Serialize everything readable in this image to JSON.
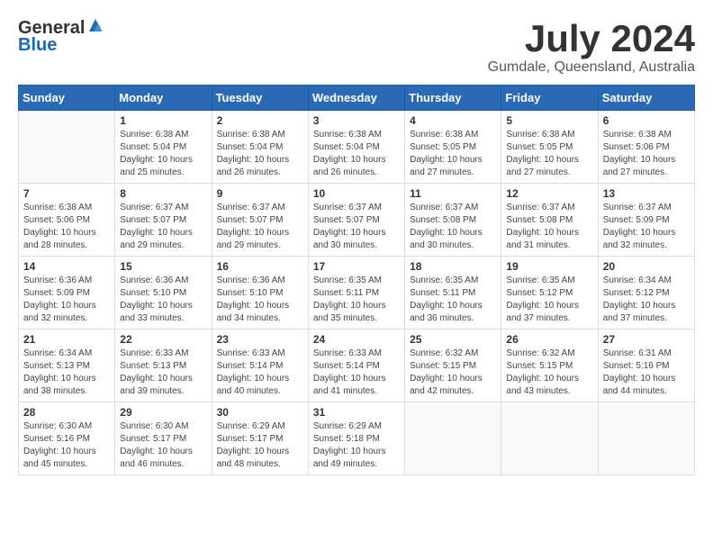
{
  "logo": {
    "general": "General",
    "blue": "Blue"
  },
  "title": "July 2024",
  "subtitle": "Gumdale, Queensland, Australia",
  "days_of_week": [
    "Sunday",
    "Monday",
    "Tuesday",
    "Wednesday",
    "Thursday",
    "Friday",
    "Saturday"
  ],
  "weeks": [
    [
      {
        "day": "",
        "info": ""
      },
      {
        "day": "1",
        "info": "Sunrise: 6:38 AM\nSunset: 5:04 PM\nDaylight: 10 hours\nand 25 minutes."
      },
      {
        "day": "2",
        "info": "Sunrise: 6:38 AM\nSunset: 5:04 PM\nDaylight: 10 hours\nand 26 minutes."
      },
      {
        "day": "3",
        "info": "Sunrise: 6:38 AM\nSunset: 5:04 PM\nDaylight: 10 hours\nand 26 minutes."
      },
      {
        "day": "4",
        "info": "Sunrise: 6:38 AM\nSunset: 5:05 PM\nDaylight: 10 hours\nand 27 minutes."
      },
      {
        "day": "5",
        "info": "Sunrise: 6:38 AM\nSunset: 5:05 PM\nDaylight: 10 hours\nand 27 minutes."
      },
      {
        "day": "6",
        "info": "Sunrise: 6:38 AM\nSunset: 5:06 PM\nDaylight: 10 hours\nand 27 minutes."
      }
    ],
    [
      {
        "day": "7",
        "info": "Sunrise: 6:38 AM\nSunset: 5:06 PM\nDaylight: 10 hours\nand 28 minutes."
      },
      {
        "day": "8",
        "info": "Sunrise: 6:37 AM\nSunset: 5:07 PM\nDaylight: 10 hours\nand 29 minutes."
      },
      {
        "day": "9",
        "info": "Sunrise: 6:37 AM\nSunset: 5:07 PM\nDaylight: 10 hours\nand 29 minutes."
      },
      {
        "day": "10",
        "info": "Sunrise: 6:37 AM\nSunset: 5:07 PM\nDaylight: 10 hours\nand 30 minutes."
      },
      {
        "day": "11",
        "info": "Sunrise: 6:37 AM\nSunset: 5:08 PM\nDaylight: 10 hours\nand 30 minutes."
      },
      {
        "day": "12",
        "info": "Sunrise: 6:37 AM\nSunset: 5:08 PM\nDaylight: 10 hours\nand 31 minutes."
      },
      {
        "day": "13",
        "info": "Sunrise: 6:37 AM\nSunset: 5:09 PM\nDaylight: 10 hours\nand 32 minutes."
      }
    ],
    [
      {
        "day": "14",
        "info": "Sunrise: 6:36 AM\nSunset: 5:09 PM\nDaylight: 10 hours\nand 32 minutes."
      },
      {
        "day": "15",
        "info": "Sunrise: 6:36 AM\nSunset: 5:10 PM\nDaylight: 10 hours\nand 33 minutes."
      },
      {
        "day": "16",
        "info": "Sunrise: 6:36 AM\nSunset: 5:10 PM\nDaylight: 10 hours\nand 34 minutes."
      },
      {
        "day": "17",
        "info": "Sunrise: 6:35 AM\nSunset: 5:11 PM\nDaylight: 10 hours\nand 35 minutes."
      },
      {
        "day": "18",
        "info": "Sunrise: 6:35 AM\nSunset: 5:11 PM\nDaylight: 10 hours\nand 36 minutes."
      },
      {
        "day": "19",
        "info": "Sunrise: 6:35 AM\nSunset: 5:12 PM\nDaylight: 10 hours\nand 37 minutes."
      },
      {
        "day": "20",
        "info": "Sunrise: 6:34 AM\nSunset: 5:12 PM\nDaylight: 10 hours\nand 37 minutes."
      }
    ],
    [
      {
        "day": "21",
        "info": "Sunrise: 6:34 AM\nSunset: 5:13 PM\nDaylight: 10 hours\nand 38 minutes."
      },
      {
        "day": "22",
        "info": "Sunrise: 6:33 AM\nSunset: 5:13 PM\nDaylight: 10 hours\nand 39 minutes."
      },
      {
        "day": "23",
        "info": "Sunrise: 6:33 AM\nSunset: 5:14 PM\nDaylight: 10 hours\nand 40 minutes."
      },
      {
        "day": "24",
        "info": "Sunrise: 6:33 AM\nSunset: 5:14 PM\nDaylight: 10 hours\nand 41 minutes."
      },
      {
        "day": "25",
        "info": "Sunrise: 6:32 AM\nSunset: 5:15 PM\nDaylight: 10 hours\nand 42 minutes."
      },
      {
        "day": "26",
        "info": "Sunrise: 6:32 AM\nSunset: 5:15 PM\nDaylight: 10 hours\nand 43 minutes."
      },
      {
        "day": "27",
        "info": "Sunrise: 6:31 AM\nSunset: 5:16 PM\nDaylight: 10 hours\nand 44 minutes."
      }
    ],
    [
      {
        "day": "28",
        "info": "Sunrise: 6:30 AM\nSunset: 5:16 PM\nDaylight: 10 hours\nand 45 minutes."
      },
      {
        "day": "29",
        "info": "Sunrise: 6:30 AM\nSunset: 5:17 PM\nDaylight: 10 hours\nand 46 minutes."
      },
      {
        "day": "30",
        "info": "Sunrise: 6:29 AM\nSunset: 5:17 PM\nDaylight: 10 hours\nand 48 minutes."
      },
      {
        "day": "31",
        "info": "Sunrise: 6:29 AM\nSunset: 5:18 PM\nDaylight: 10 hours\nand 49 minutes."
      },
      {
        "day": "",
        "info": ""
      },
      {
        "day": "",
        "info": ""
      },
      {
        "day": "",
        "info": ""
      }
    ]
  ]
}
